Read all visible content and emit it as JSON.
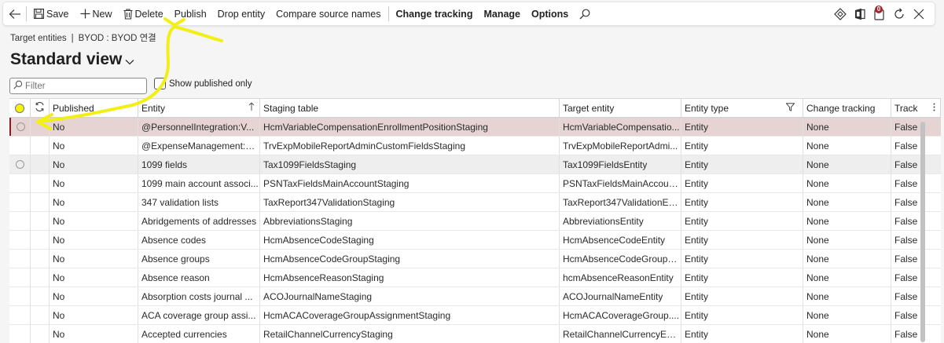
{
  "toolbar": {
    "back_label": "",
    "save_label": "Save",
    "new_label": "New",
    "delete_label": "Delete",
    "publish_label": "Publish",
    "drop_entity_label": "Drop entity",
    "compare_label": "Compare source names",
    "change_tracking_label": "Change tracking",
    "manage_label": "Manage",
    "options_label": "Options",
    "notification_count": "0"
  },
  "breadcrumb": {
    "item1": "Target entities",
    "separator": "|",
    "item2": "BYOD : BYOD 연결"
  },
  "view": {
    "title": "Standard view"
  },
  "filter": {
    "placeholder": "Filter",
    "show_published_label": "Show published only"
  },
  "grid": {
    "columns": {
      "published": "Published",
      "entity": "Entity",
      "staging": "Staging table",
      "target": "Target entity",
      "type": "Entity type",
      "change": "Change tracking",
      "track": "Track"
    },
    "rows": [
      {
        "published": "No",
        "entity": "@PersonnelIntegration:V...",
        "staging": "HcmVariableCompensationEnrollmentPositionStaging",
        "target": "HcmVariableCompensatio...",
        "type": "Entity",
        "change": "None",
        "track": "False"
      },
      {
        "published": "No",
        "entity": "@ExpenseManagement:Tr...",
        "staging": "TrvExpMobileReportAdminCustomFieldsStaging",
        "target": "TrvExpMobileReportAdmi...",
        "type": "Entity",
        "change": "None",
        "track": "False"
      },
      {
        "published": "No",
        "entity": "1099 fields",
        "staging": "Tax1099FieldsStaging",
        "target": "Tax1099FieldsEntity",
        "type": "Entity",
        "change": "None",
        "track": "False"
      },
      {
        "published": "No",
        "entity": "1099 main account associ...",
        "staging": "PSNTaxFieldsMainAccountStaging",
        "target": "PSNTaxFieldsMainAccoun...",
        "type": "Entity",
        "change": "None",
        "track": "False"
      },
      {
        "published": "No",
        "entity": "347 validation lists",
        "staging": "TaxReport347ValidationStaging",
        "target": "TaxReport347ValidationEn...",
        "type": "Entity",
        "change": "None",
        "track": "False"
      },
      {
        "published": "No",
        "entity": "Abridgements of addresses",
        "staging": "AbbreviationsStaging",
        "target": "AbbreviationsEntity",
        "type": "Entity",
        "change": "None",
        "track": "False"
      },
      {
        "published": "No",
        "entity": "Absence codes",
        "staging": "HcmAbsenceCodeStaging",
        "target": "HcmAbsenceCodeEntity",
        "type": "Entity",
        "change": "None",
        "track": "False"
      },
      {
        "published": "No",
        "entity": "Absence groups",
        "staging": "HcmAbsenceCodeGroupStaging",
        "target": "HcmAbsenceCodeGroupE...",
        "type": "Entity",
        "change": "None",
        "track": "False"
      },
      {
        "published": "No",
        "entity": "Absence reason",
        "staging": "HcmAbsenceReasonStaging",
        "target": "hcmAbsenceReasonEntity",
        "type": "Entity",
        "change": "None",
        "track": "False"
      },
      {
        "published": "No",
        "entity": "Absorption costs journal ...",
        "staging": "ACOJournalNameStaging",
        "target": "ACOJournalNameEntity",
        "type": "Entity",
        "change": "None",
        "track": "False"
      },
      {
        "published": "No",
        "entity": "ACA coverage group assi...",
        "staging": "HcmACACoverageGroupAssignmentStaging",
        "target": "HcmACACoverageGroup....",
        "type": "Entity",
        "change": "None",
        "track": "False"
      },
      {
        "published": "No",
        "entity": "Accepted currencies",
        "staging": "RetailChannelCurrencyStaging",
        "target": "RetailChannelCurrencyEnt...",
        "type": "Entity",
        "change": "None",
        "track": "False"
      }
    ]
  },
  "colors": {
    "selected_row": "#e6d4d4",
    "hover_row": "#eeeeee",
    "annotation": "#f4f40a"
  }
}
